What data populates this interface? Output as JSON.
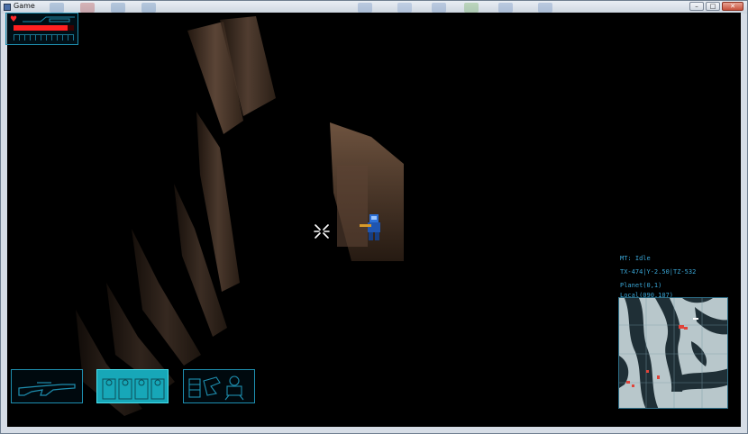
{
  "window": {
    "title": "Game",
    "buttons": {
      "minimize": "–",
      "maximize": "□",
      "close": "✕"
    }
  },
  "hud": {
    "health": {
      "icon": "heart-icon",
      "glyph": "♥",
      "level": 0.9,
      "color": "#ff2020"
    },
    "status": {
      "mt": "MT: Idle",
      "coords": "TX-474|Y-2.50|TZ-532",
      "planet": "Planet(0,1)",
      "local": "Local(090,107)"
    },
    "inventory": [
      {
        "name": "rifle-weapon-slot",
        "icon": "rifle-icon",
        "selected": false
      },
      {
        "name": "squad-slot",
        "icon": "squad-icon",
        "selected": true
      },
      {
        "name": "robot-slot",
        "icon": "robot-icon",
        "selected": false
      }
    ]
  },
  "colors": {
    "hud_accent": "#1e8fb0",
    "status_text": "#3aa6d6",
    "selected_slot": "#17a7b8"
  }
}
